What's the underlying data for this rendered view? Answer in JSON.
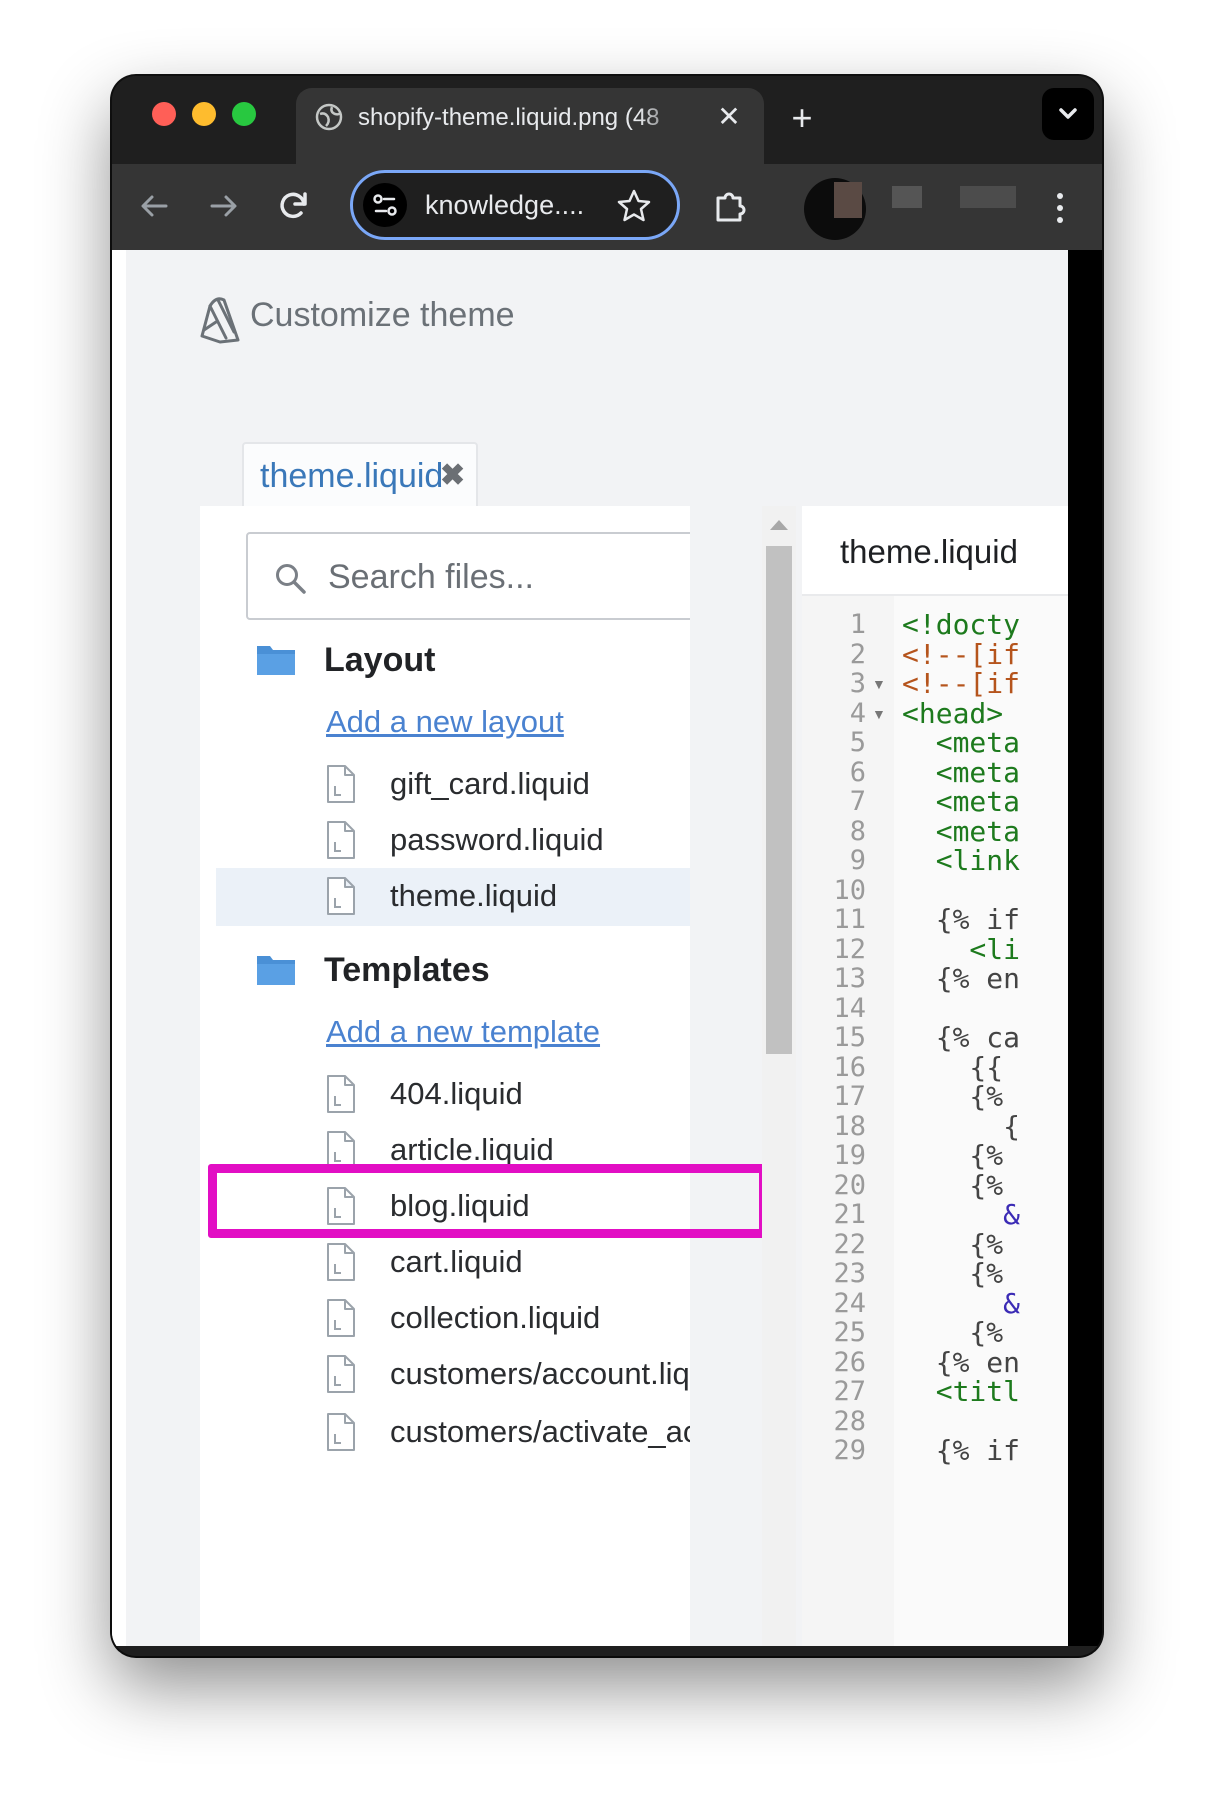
{
  "browser": {
    "tab_title": "shopify-theme.liquid.png (48",
    "tab_close": "✕",
    "new_tab": "+",
    "address": "knowledge...."
  },
  "page": {
    "title": "Customize theme",
    "open_file_tab": {
      "label": "theme.liquid",
      "close": "✖"
    }
  },
  "sidebar": {
    "search_placeholder": "Search files...",
    "sections": [
      {
        "label": "Layout",
        "add_link": "Add a new layout",
        "files": [
          "gift_card.liquid",
          "password.liquid",
          "theme.liquid"
        ]
      },
      {
        "label": "Templates",
        "add_link": "Add a new template",
        "files": [
          "404.liquid",
          "article.liquid",
          "blog.liquid",
          "cart.liquid",
          "collection.liquid",
          "customers/account.liquid",
          "customers/activate_account.liquid"
        ]
      }
    ],
    "selected_file": "theme.liquid"
  },
  "editor": {
    "title": "theme.liquid",
    "line_numbers": [
      "1",
      "2",
      "3",
      "4",
      "5",
      "6",
      "7",
      "8",
      "9",
      "10",
      "11",
      "12",
      "13",
      "14",
      "15",
      "16",
      "17",
      "18",
      "19",
      "20",
      "21",
      "22",
      "23",
      "24",
      "25",
      "26",
      "27",
      "28",
      "29"
    ],
    "code_lines": [
      "<!docty",
      "<!--[if",
      "<!--[if",
      "<head>",
      "  <meta",
      "  <meta",
      "  <meta",
      "  <meta",
      "  <link",
      "",
      "  {% if",
      "    <li",
      "  {% en",
      "",
      "  {% ca",
      "    {{",
      "    {%",
      "      {",
      "    {%",
      "    {%",
      "      &",
      "    {%",
      "    {%",
      "      &",
      "    {%",
      "  {% en",
      "  <titl",
      "",
      "  {% if"
    ]
  },
  "colors": {
    "highlight": "#e20ec4",
    "link": "#4a82d0",
    "tab_label": "#3a78b9"
  }
}
